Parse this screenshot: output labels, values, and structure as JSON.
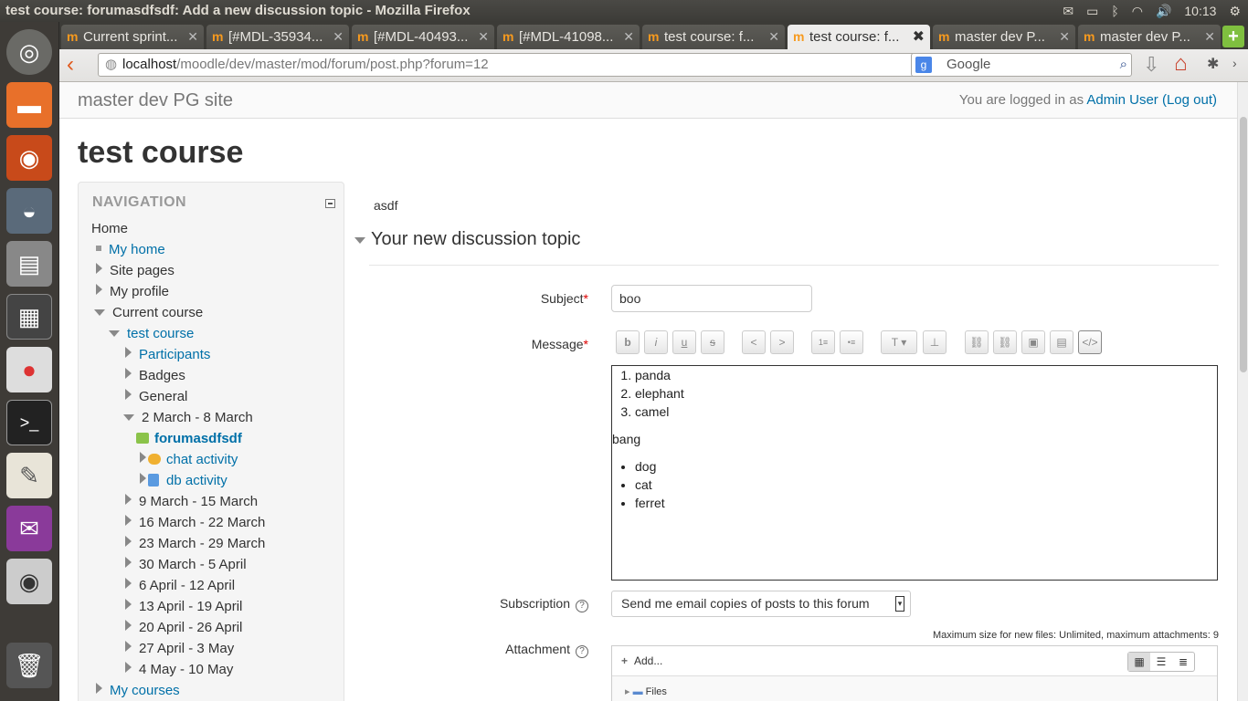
{
  "window_title": "test course: forumasdfsdf: Add a new discussion topic - Mozilla Firefox",
  "clock": "10:13",
  "tabs": [
    {
      "label": "Current sprint..."
    },
    {
      "label": "[#MDL-35934..."
    },
    {
      "label": "[#MDL-40493..."
    },
    {
      "label": "[#MDL-41098..."
    },
    {
      "label": "test course: f..."
    },
    {
      "label": "test course: f..."
    },
    {
      "label": "master dev P..."
    },
    {
      "label": "master dev P..."
    }
  ],
  "url": {
    "host": "localhost",
    "path": "/moodle/dev/master/mod/forum/post.php?forum=12"
  },
  "search": {
    "placeholder": "Google"
  },
  "header": {
    "site_name": "master dev PG site",
    "logged_in_prefix": "You are logged in as",
    "user": "Admin User",
    "logout": "(Log out)"
  },
  "course_title": "test course",
  "nav": {
    "heading": "NAVIGATION",
    "home": "Home",
    "my_home": "My home",
    "site_pages": "Site pages",
    "my_profile": "My profile",
    "current_course": "Current course",
    "test_course": "test course",
    "participants": "Participants",
    "badges": "Badges",
    "general": "General",
    "week1": "2 March - 8 March",
    "forum": "forumasdfsdf",
    "chat": "chat activity",
    "db": "db activity",
    "weeks": [
      "9 March - 15 March",
      "16 March - 22 March",
      "23 March - 29 March",
      "30 March - 5 April",
      "6 April - 12 April",
      "13 April - 19 April",
      "20 April - 26 April",
      "27 April - 3 May",
      "4 May - 10 May"
    ],
    "my_courses": "My courses"
  },
  "form": {
    "intro": "asdf",
    "legend": "Your new discussion topic",
    "subject_label": "Subject",
    "subject_value": "boo",
    "message_label": "Message",
    "message": {
      "ordered": [
        "panda",
        "elephant",
        "camel"
      ],
      "paragraph": "bang",
      "bullets": [
        "dog",
        "cat",
        "ferret"
      ]
    },
    "subscription_label": "Subscription",
    "subscription_value": "Send me email copies of posts to this forum",
    "attachment_label": "Attachment",
    "max_size": "Maximum size for new files: Unlimited, maximum attachments: 9",
    "add_label": "Add...",
    "files_label": "Files"
  }
}
